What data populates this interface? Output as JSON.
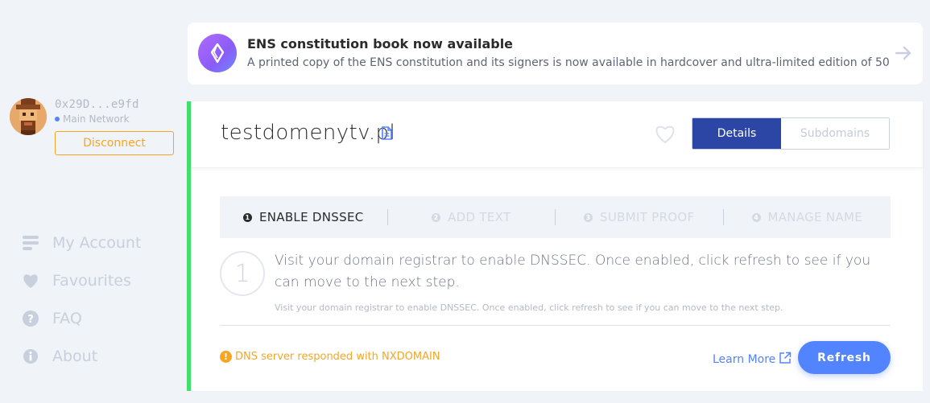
{
  "account": {
    "address": "0x29D...e9fd",
    "network": "Main Network",
    "disconnect_label": "Disconnect"
  },
  "nav": {
    "items": [
      {
        "label": "My Account",
        "icon": "account-icon"
      },
      {
        "label": "Favourites",
        "icon": "heart-icon"
      },
      {
        "label": "FAQ",
        "icon": "question-icon"
      },
      {
        "label": "About",
        "icon": "info-icon"
      }
    ]
  },
  "banner": {
    "title": "ENS constitution book now available",
    "text": "A printed copy of the ENS constitution and its signers is now available in hardcover and ultra-limited edition of 50",
    "icon": "ens-logo",
    "arrow_icon": "arrow-right-icon"
  },
  "domain": {
    "name": "testdomenytv.pl",
    "tabs": {
      "details": "Details",
      "subdomains": "Subdomains"
    }
  },
  "steps": [
    {
      "num": "1",
      "label": "ENABLE DNSSEC",
      "active": true
    },
    {
      "num": "2",
      "label": "ADD TEXT",
      "active": false
    },
    {
      "num": "3",
      "label": "SUBMIT PROOF",
      "active": false
    },
    {
      "num": "4",
      "label": "MANAGE NAME",
      "active": false
    }
  ],
  "step_detail": {
    "number": "1",
    "instruction": "Visit your domain registrar to enable DNSSEC. Once enabled, click refresh to see if you can move to the next step.",
    "instruction_small": "Visit your domain registrar to enable DNSSEC. Once enabled, click refresh to see if you can move to the next step."
  },
  "status": {
    "message": "DNS server responded with NXDOMAIN",
    "color": "#f5a623"
  },
  "actions": {
    "learn_more": "Learn More",
    "refresh": "Refresh"
  },
  "colors": {
    "accent": "#5284ff",
    "tab_active": "#2c46a6",
    "success_border": "#42e068",
    "warning": "#f5a623"
  }
}
